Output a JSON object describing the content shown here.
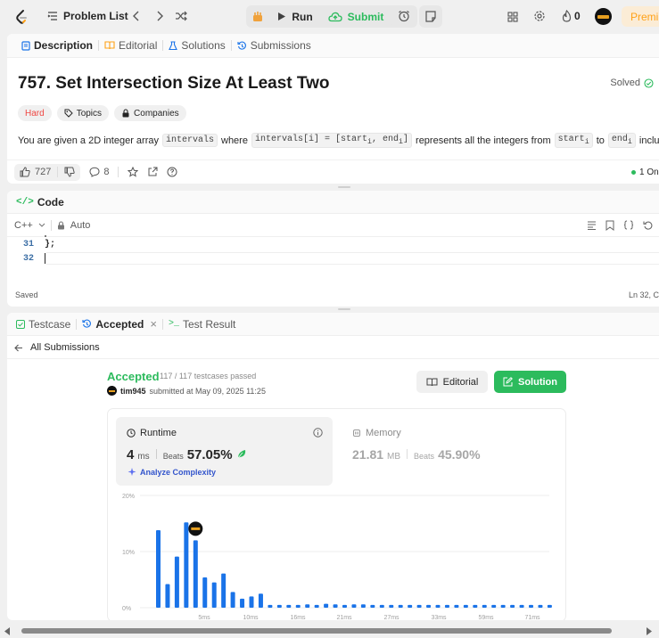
{
  "topbar": {
    "problem_list": "Problem List",
    "run": "Run",
    "submit": "Submit",
    "streak": "0",
    "premium": "Premiu"
  },
  "description_panel": {
    "tabs": [
      "Description",
      "Editorial",
      "Solutions",
      "Submissions"
    ],
    "title": "757. Set Intersection Size At Least Two",
    "solved": "Solved",
    "difficulty": "Hard",
    "topics": "Topics",
    "companies": "Companies",
    "statement": {
      "p1": "You are given a 2D integer array",
      "c1": "intervals",
      "p2": "where",
      "c2": "intervals[i] = [start",
      "c2sub1": "i",
      "c2mid": ", end",
      "c2sub2": "i",
      "c2end": "]",
      "p3": "represents all the integers from",
      "c3": "start",
      "c3sub": "i",
      "p4": "to",
      "c4": "end",
      "c4sub": "i",
      "p5": "inclusively."
    },
    "likes": "727",
    "comments": "8",
    "online": "1 On"
  },
  "code_panel": {
    "title": "Code",
    "language": "C++",
    "mode": "Auto",
    "lines": [
      {
        "no": "31",
        "text": "};"
      },
      {
        "no": "32",
        "text": ""
      }
    ],
    "saved": "Saved",
    "cursor": "Ln 32, C"
  },
  "result_panel": {
    "tabs": [
      "Testcase",
      "Accepted",
      "Test Result"
    ],
    "back": "All Submissions",
    "status": "Accepted",
    "testcases": "117 / 117 testcases passed",
    "user": "tim945",
    "submitted": "submitted at May 09, 2025 11:25",
    "editorial_btn": "Editorial",
    "solution_btn": "Solution",
    "runtime_label": "Runtime",
    "runtime_value": "4",
    "runtime_unit": "ms",
    "beats_label": "Beats",
    "runtime_beats": "57.05%",
    "analyze": "Analyze Complexity",
    "memory_label": "Memory",
    "memory_value": "21.81",
    "memory_unit": "MB",
    "memory_beats": "45.90%"
  },
  "colors": {
    "accent": "#ffa116",
    "green": "#2cbb5d",
    "bar": "#1a73e8",
    "hard": "#ef4743"
  },
  "chart_data": {
    "type": "bar",
    "title": "",
    "xlabel": "",
    "ylabel": "",
    "y_ticks": [
      "20%",
      "10%",
      "0%"
    ],
    "ylim": [
      0,
      20
    ],
    "x_tick_labels": [
      "5ms",
      "10ms",
      "16ms",
      "21ms",
      "27ms",
      "33ms",
      "59ms",
      "71ms"
    ],
    "values": [
      13.8,
      4.2,
      9.1,
      15.2,
      12.0,
      5.4,
      4.5,
      6.1,
      2.8,
      1.6,
      2.0,
      2.5,
      0.5,
      0.5,
      0.5,
      0.5,
      0.6,
      0.5,
      0.7,
      0.6,
      0.5,
      0.6,
      0.6,
      0.5,
      0.5,
      0.5,
      0.5,
      0.5,
      0.5,
      0.5,
      0.5,
      0.5,
      0.5,
      0.5,
      0.5,
      0.5,
      0.5,
      0.5,
      0.5,
      0.5,
      0.5,
      0.5,
      0.5
    ],
    "highlight_index": 4,
    "grid": true
  }
}
